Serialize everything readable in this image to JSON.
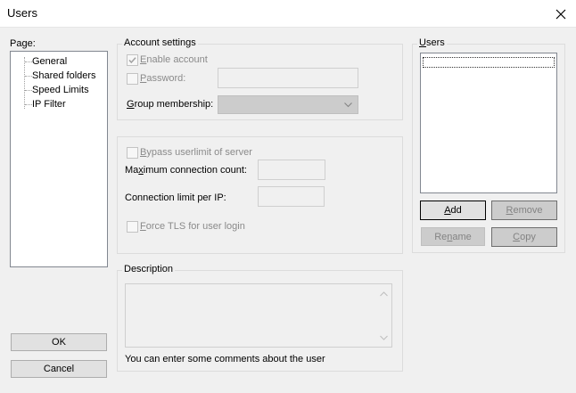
{
  "window": {
    "title": "Users"
  },
  "page_panel": {
    "label": "Page:",
    "items": [
      "General",
      "Shared folders",
      "Speed Limits",
      "IP Filter"
    ]
  },
  "account_settings": {
    "legend": "Account settings",
    "enable_account": {
      "prefix": "",
      "mnemonic": "E",
      "rest": "nable account",
      "checked": true
    },
    "password": {
      "prefix": "",
      "mnemonic": "P",
      "rest": "assword:",
      "checked": false,
      "value": ""
    },
    "group_membership": {
      "prefix": "",
      "mnemonic": "G",
      "rest": "roup membership:",
      "selected": ""
    }
  },
  "limits": {
    "bypass": {
      "prefix": "",
      "mnemonic": "B",
      "rest": "ypass userlimit of server",
      "checked": false
    },
    "max_connections": {
      "prefix": "Ma",
      "mnemonic": "x",
      "rest": "imum connection count:",
      "value": ""
    },
    "limit_per_ip": {
      "label": "Connection limit per IP:",
      "value": ""
    },
    "force_tls": {
      "prefix": "",
      "mnemonic": "F",
      "rest": "orce TLS for user login",
      "checked": false
    }
  },
  "description": {
    "legend": "Description",
    "value": "",
    "hint": "You can enter some comments about the user"
  },
  "users_panel": {
    "legend_prefix": "",
    "legend_mnemonic": "U",
    "legend_rest": "sers",
    "items": []
  },
  "buttons": {
    "add": {
      "prefix": "",
      "mnemonic": "A",
      "rest": "dd"
    },
    "remove": {
      "prefix": "",
      "mnemonic": "R",
      "rest": "emove"
    },
    "rename": {
      "prefix": "Re",
      "mnemonic": "n",
      "rest": "ame"
    },
    "copy": {
      "prefix": "",
      "mnemonic": "C",
      "rest": "opy"
    },
    "ok": "OK",
    "cancel": "Cancel"
  },
  "colors": {
    "window_bg": "#f0f0f0",
    "disabled_text": "#8a8a8a",
    "list_border": "#828790"
  }
}
